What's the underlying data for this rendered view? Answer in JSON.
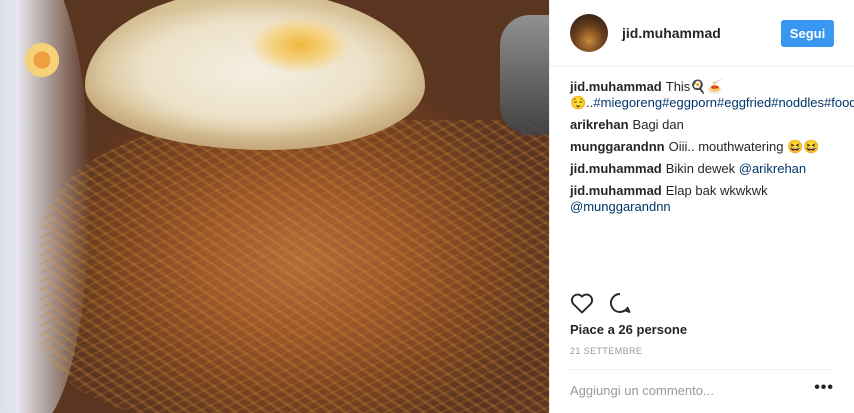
{
  "post": {
    "author": "jid.muhammad",
    "follow_label": "Segui",
    "caption": {
      "user": "jid.muhammad",
      "text_prefix": "This🍳🍝",
      "text_line2_prefix": "😌..",
      "tags": "#miegoreng#eggporn#eggfried#noddles#foodporn"
    },
    "comments": [
      {
        "user": "arikrehan",
        "text": "Bagi dan"
      },
      {
        "user": "munggarandnn",
        "text": "Oiii.. mouthwatering 😆😆"
      },
      {
        "user": "jid.muhammad",
        "text": "Bikin dewek",
        "mention": "@arikrehan"
      },
      {
        "user": "jid.muhammad",
        "text": "Elap bak wkwkwk",
        "mention": "@munggarandnn"
      }
    ],
    "likes": "Piace a 26 persone",
    "date": "21 SETTEMBRE",
    "comment_placeholder": "Aggiungi un commento...",
    "more_label": "•••",
    "icons": {
      "like": "heart-icon",
      "comment": "comment-icon"
    }
  },
  "colors": {
    "link": "#003569",
    "follow_button": "#3897f0"
  }
}
